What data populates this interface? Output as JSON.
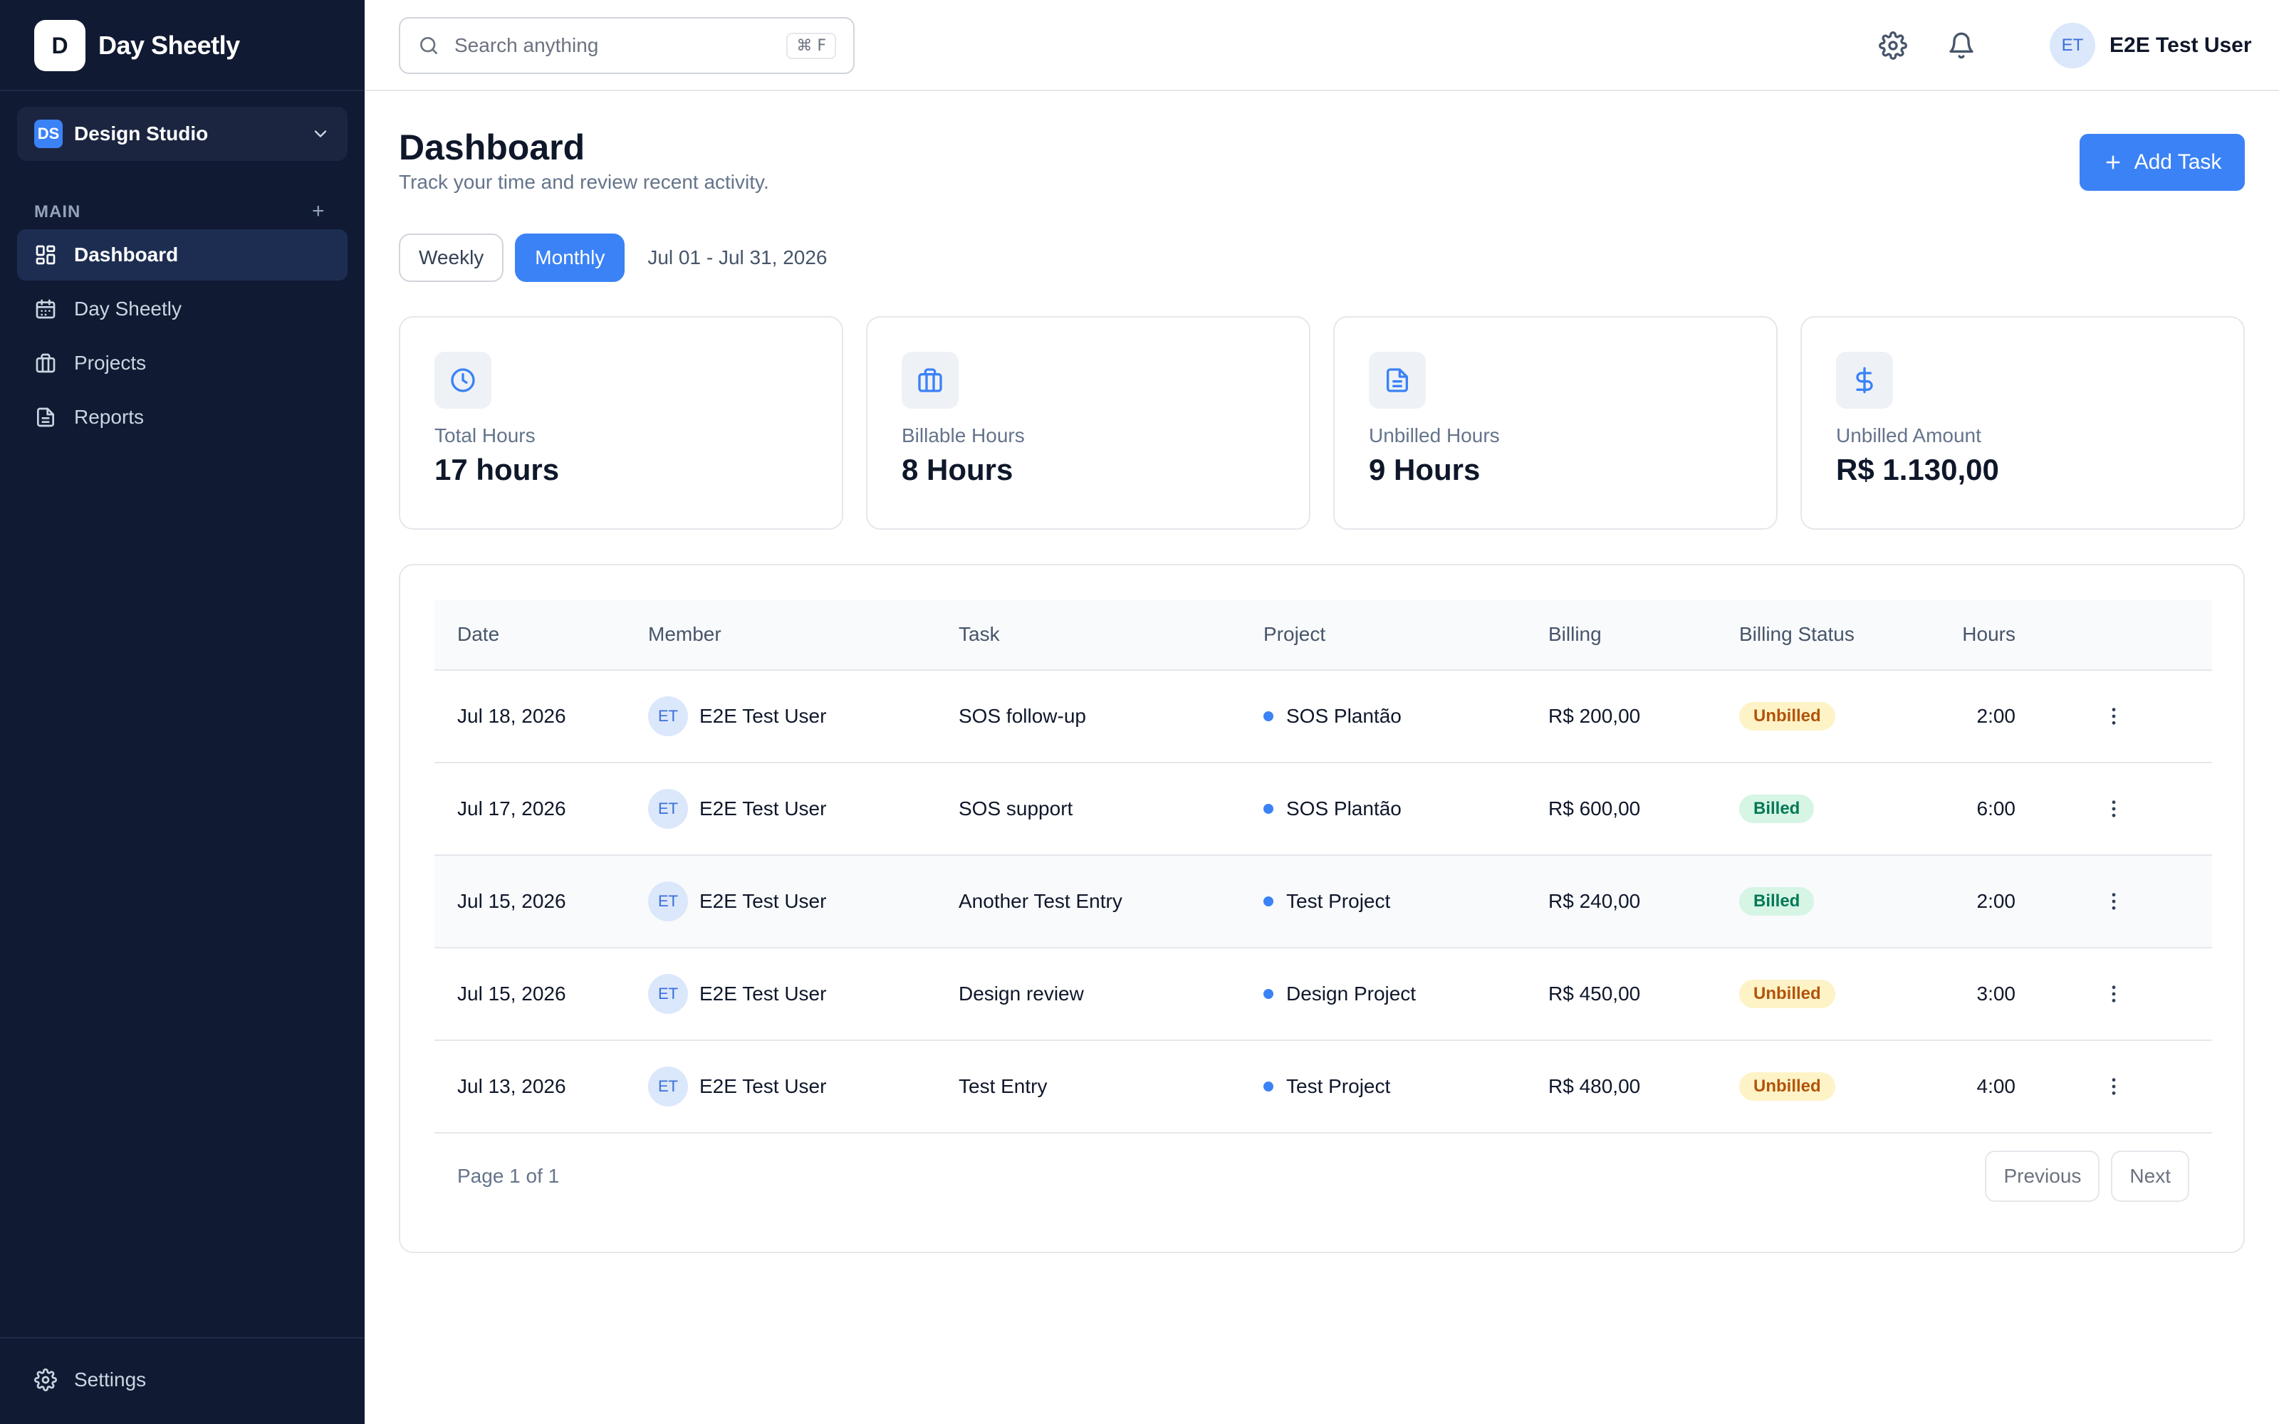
{
  "brand": {
    "logo_letter": "D",
    "name": "Day Sheetly"
  },
  "workspace": {
    "badge": "DS",
    "name": "Design Studio"
  },
  "sidebar": {
    "section_label": "MAIN",
    "items": [
      {
        "label": "Dashboard",
        "icon": "dashboard-icon",
        "active": true
      },
      {
        "label": "Day Sheetly",
        "icon": "calendar-icon",
        "active": false
      },
      {
        "label": "Projects",
        "icon": "briefcase-icon",
        "active": false
      },
      {
        "label": "Reports",
        "icon": "document-icon",
        "active": false
      }
    ],
    "settings_label": "Settings"
  },
  "topbar": {
    "search_placeholder": "Search anything",
    "search_shortcut": "⌘ F",
    "user_initials": "ET",
    "user_name": "E2E Test User"
  },
  "page": {
    "title": "Dashboard",
    "subtitle": "Track your time and review recent activity.",
    "add_task_label": "Add Task",
    "ranges": [
      {
        "label": "Weekly",
        "active": false
      },
      {
        "label": "Monthly",
        "active": true
      }
    ],
    "date_range": "Jul 01 - Jul 31, 2026"
  },
  "stats": [
    {
      "label": "Total Hours",
      "value": "17 hours",
      "icon": "clock-icon"
    },
    {
      "label": "Billable Hours",
      "value": "8 Hours",
      "icon": "briefcase-icon"
    },
    {
      "label": "Unbilled Hours",
      "value": "9 Hours",
      "icon": "document-icon"
    },
    {
      "label": "Unbilled Amount",
      "value": "R$ 1.130,00",
      "icon": "dollar-icon"
    }
  ],
  "table": {
    "columns": [
      "Date",
      "Member",
      "Task",
      "Project",
      "Billing",
      "Billing Status",
      "Hours"
    ],
    "rows": [
      {
        "date": "Jul 18, 2026",
        "member_initials": "ET",
        "member": "E2E Test User",
        "task": "SOS follow-up",
        "project": "SOS Plantão",
        "billing": "R$ 200,00",
        "status": "Unbilled",
        "hours": "2:00"
      },
      {
        "date": "Jul 17, 2026",
        "member_initials": "ET",
        "member": "E2E Test User",
        "task": "SOS support",
        "project": "SOS Plantão",
        "billing": "R$ 600,00",
        "status": "Billed",
        "hours": "6:00"
      },
      {
        "date": "Jul 15, 2026",
        "member_initials": "ET",
        "member": "E2E Test User",
        "task": "Another Test Entry",
        "project": "Test Project",
        "billing": "R$ 240,00",
        "status": "Billed",
        "hours": "2:00"
      },
      {
        "date": "Jul 15, 2026",
        "member_initials": "ET",
        "member": "E2E Test User",
        "task": "Design review",
        "project": "Design Project",
        "billing": "R$ 450,00",
        "status": "Unbilled",
        "hours": "3:00"
      },
      {
        "date": "Jul 13, 2026",
        "member_initials": "ET",
        "member": "E2E Test User",
        "task": "Test Entry",
        "project": "Test Project",
        "billing": "R$ 480,00",
        "status": "Unbilled",
        "hours": "4:00"
      }
    ],
    "page_info": "Page 1 of 1",
    "prev_label": "Previous",
    "next_label": "Next"
  },
  "colors": {
    "sidebar_bg": "#111a33",
    "accent": "#3b82f6",
    "unbilled_bg": "#fdf3c7",
    "unbilled_text": "#b45309",
    "billed_bg": "#d6f5e4",
    "billed_text": "#047857"
  }
}
